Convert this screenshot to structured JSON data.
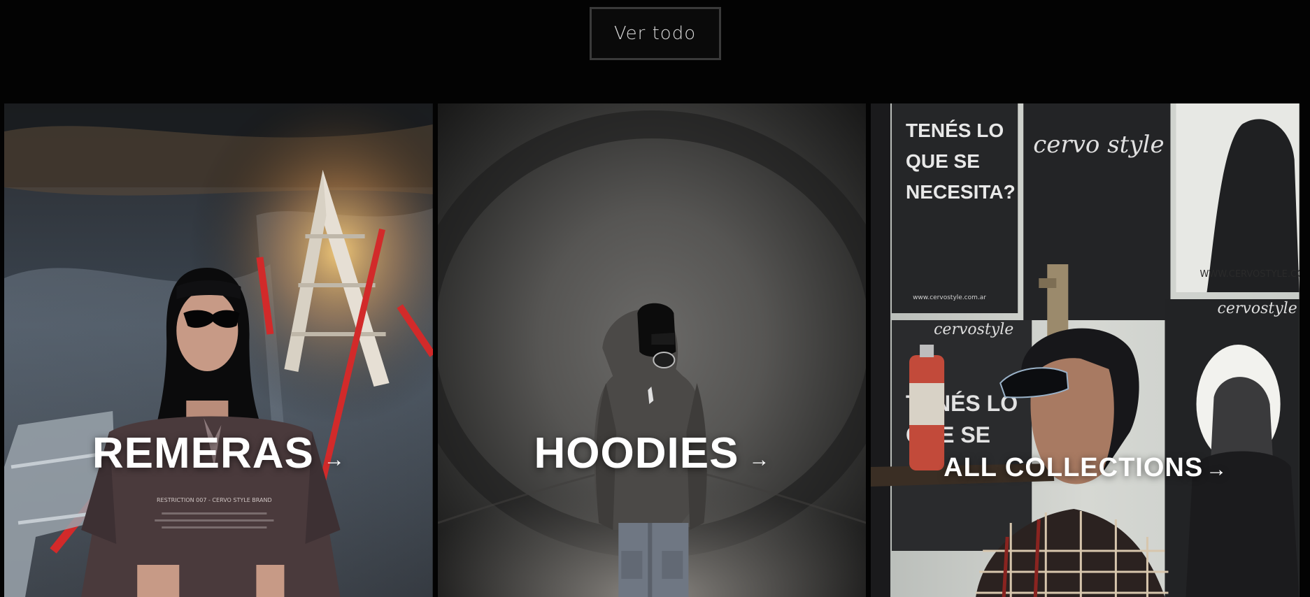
{
  "view_all": {
    "label": "Ver todo"
  },
  "cards": [
    {
      "label": "REMERAS",
      "arrow": "→"
    },
    {
      "label": "HOODIES",
      "arrow": "→"
    },
    {
      "label": "ALL COLLECTIONS",
      "arrow": "→"
    }
  ],
  "photo_text": {
    "poster_question_line1": "TENÉS LO",
    "poster_question_line2": "QUE SE",
    "poster_question_line3": "NECESITA?",
    "poster_logo": "cervo style",
    "poster_url": "WWW.CERVOSTYLE.CO",
    "poster_brand": "cervostyle",
    "poster_small_url": "www.cervostyle.com.ar",
    "poster_lower_line1": "TENÉS LO",
    "poster_lower_line2": "QUE SE",
    "tee_print": "RESTRICTION 007 - CERVO STYLE BRAND"
  }
}
